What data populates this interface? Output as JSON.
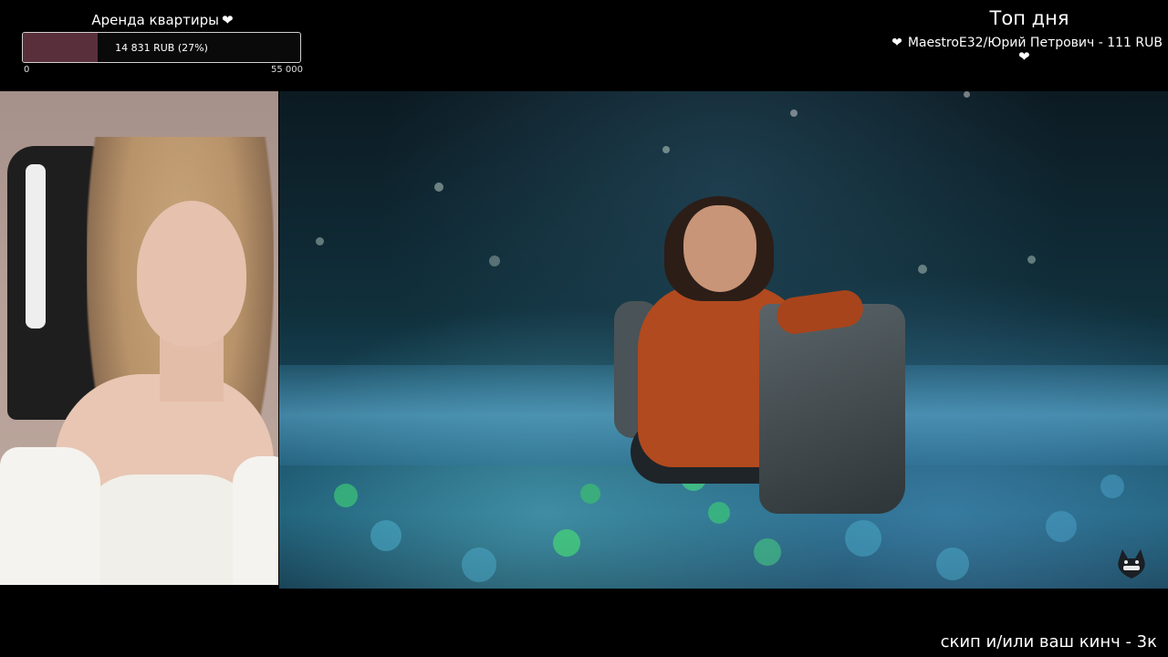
{
  "goal": {
    "title": "Аренда квартиры",
    "title_icon": "heart-icon",
    "amount_text": "14 831 RUB (27%)",
    "progress_fraction": 0.27,
    "min_label": "0",
    "max_label": "55 000",
    "fill_color": "#5a2f3c"
  },
  "top_day": {
    "title": "Топ дня",
    "entry": "MaestroE32/Юрий Петрович - 111 RUB",
    "entry_icon": "heart-icon"
  },
  "bottom": {
    "note": "скип и/или ваш кинч - 3к"
  }
}
